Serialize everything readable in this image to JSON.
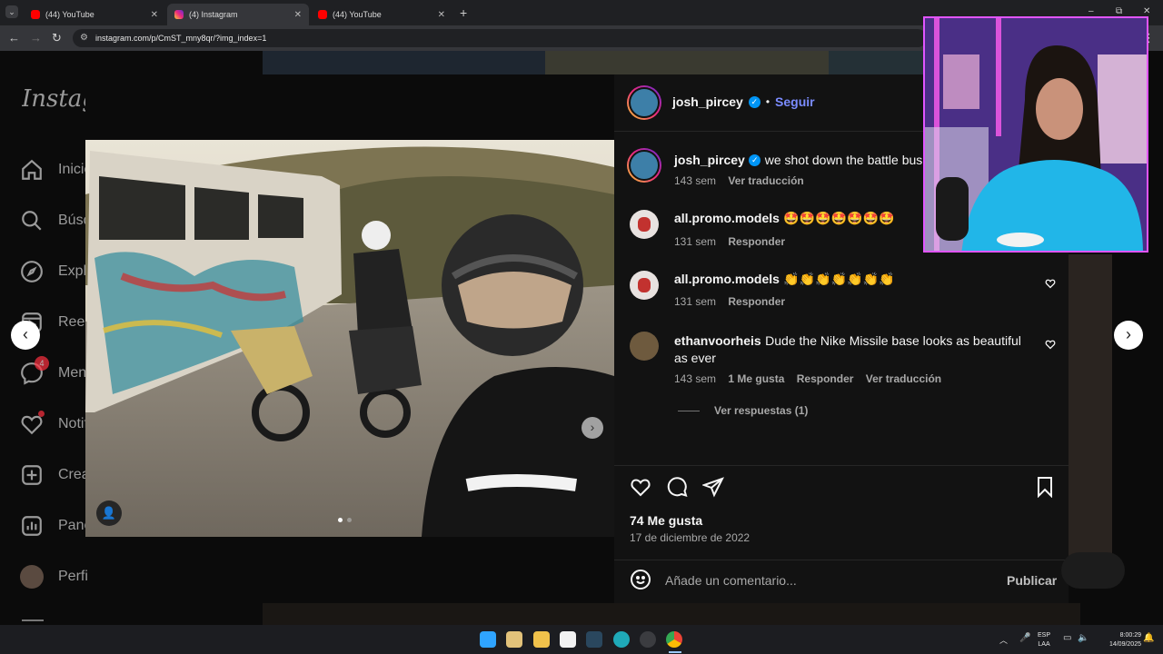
{
  "browser": {
    "tabs": [
      {
        "title": "(44) YouTube",
        "favicon": "youtube-icon",
        "active": false
      },
      {
        "title": "(4) Instagram",
        "favicon": "instagram-icon",
        "active": true
      },
      {
        "title": "(44) YouTube",
        "favicon": "youtube-icon",
        "active": false
      }
    ],
    "new_tab": "+",
    "url": "instagram.com/p/CmST_mny8qr/?img_index=1",
    "window_controls": [
      "–",
      "⧉",
      "✕"
    ]
  },
  "sidebar": {
    "logo": "Instagram",
    "items": [
      {
        "label": "Inicio",
        "icon": "home-icon"
      },
      {
        "label": "Búsqueda",
        "icon": "search-icon"
      },
      {
        "label": "Explorar",
        "icon": "compass-icon"
      },
      {
        "label": "Reels",
        "icon": "reels-icon"
      },
      {
        "label": "Mensajes",
        "icon": "messenger-icon",
        "badge": "4"
      },
      {
        "label": "Notificaciones",
        "icon": "heart-icon"
      },
      {
        "label": "Crear",
        "icon": "plus-square-icon"
      },
      {
        "label": "Panel",
        "icon": "dashboard-icon"
      },
      {
        "label": "Perfil",
        "icon": "avatar"
      }
    ]
  },
  "post": {
    "author": "josh_pircey",
    "dot": "•",
    "follow_label": "Seguir",
    "caption": {
      "user": "josh_pircey",
      "text": "we shot down the battle bus",
      "time": "143 sem",
      "translate": "Ver traducción"
    },
    "comments": [
      {
        "user": "all.promo.models",
        "text": "🤩🤩🤩🤩🤩🤩🤩",
        "time": "131 sem",
        "reply": "Responder"
      },
      {
        "user": "all.promo.models",
        "text": "👏👏👏👏👏👏👏",
        "time": "131 sem",
        "reply": "Responder"
      },
      {
        "user": "ethanvoorheis",
        "text": "Dude the Nike Missile base looks as beautiful as ever",
        "time": "143 sem",
        "likes": "1 Me gusta",
        "reply": "Responder",
        "translate": "Ver traducción"
      }
    ],
    "view_replies": "Ver respuestas (1)",
    "likes": "74 Me gusta",
    "date": "17 de diciembre de 2022",
    "comment_placeholder": "Añade un comentario...",
    "publish": "Publicar"
  },
  "taskbar": {
    "lang_top": "ESP",
    "lang_bottom": "LAA",
    "time": "8:00:29",
    "date": "14/09/2025"
  },
  "colors": {
    "accent": "#0095f6",
    "follow": "#7b8cff",
    "webcam_border": "#e155ff"
  }
}
